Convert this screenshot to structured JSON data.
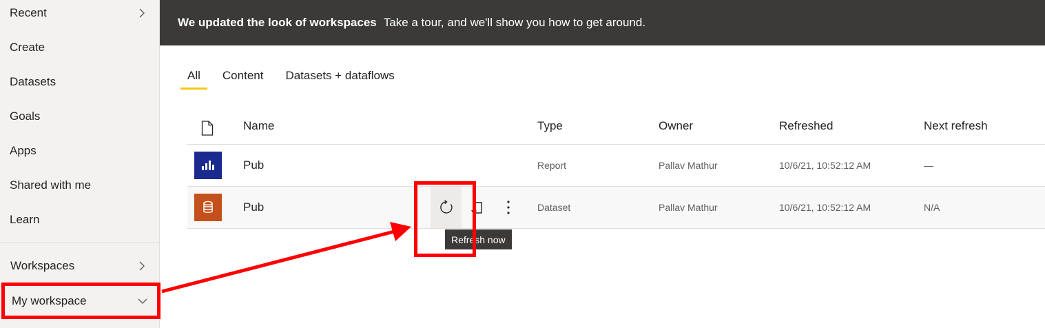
{
  "sidebar": {
    "items": [
      {
        "label": "Recent",
        "chevron": "right"
      },
      {
        "label": "Create"
      },
      {
        "label": "Datasets"
      },
      {
        "label": "Goals"
      },
      {
        "label": "Apps"
      },
      {
        "label": "Shared with me"
      },
      {
        "label": "Learn"
      },
      {
        "label": "Workspaces",
        "chevron": "right"
      },
      {
        "label": "My workspace",
        "chevron": "down"
      }
    ]
  },
  "banner": {
    "title": "We updated the look of workspaces",
    "text": "Take a tour, and we'll show you how to get around."
  },
  "tabs": [
    {
      "label": "All",
      "active": true
    },
    {
      "label": "Content"
    },
    {
      "label": "Datasets + dataflows"
    }
  ],
  "table": {
    "columns": [
      "Name",
      "Type",
      "Owner",
      "Refreshed",
      "Next refresh"
    ],
    "rows": [
      {
        "icon": "report-icon",
        "tile_color": "#1b2a8f",
        "name": "Pub",
        "type": "Report",
        "owner": "Pallav Mathur",
        "refreshed": "10/6/21, 10:52:12 AM",
        "next_refresh": "—"
      },
      {
        "icon": "dataset-icon",
        "tile_color": "#c4511b",
        "name": "Pub",
        "type": "Dataset",
        "owner": "Pallav Mathur",
        "refreshed": "10/6/21, 10:52:12 AM",
        "next_refresh": "N/A"
      }
    ]
  },
  "tooltip": {
    "text": "Refresh now"
  },
  "colors": {
    "accent": "#f2c811",
    "annotation": "#ff0000",
    "banner_bg": "#3b3a39"
  }
}
